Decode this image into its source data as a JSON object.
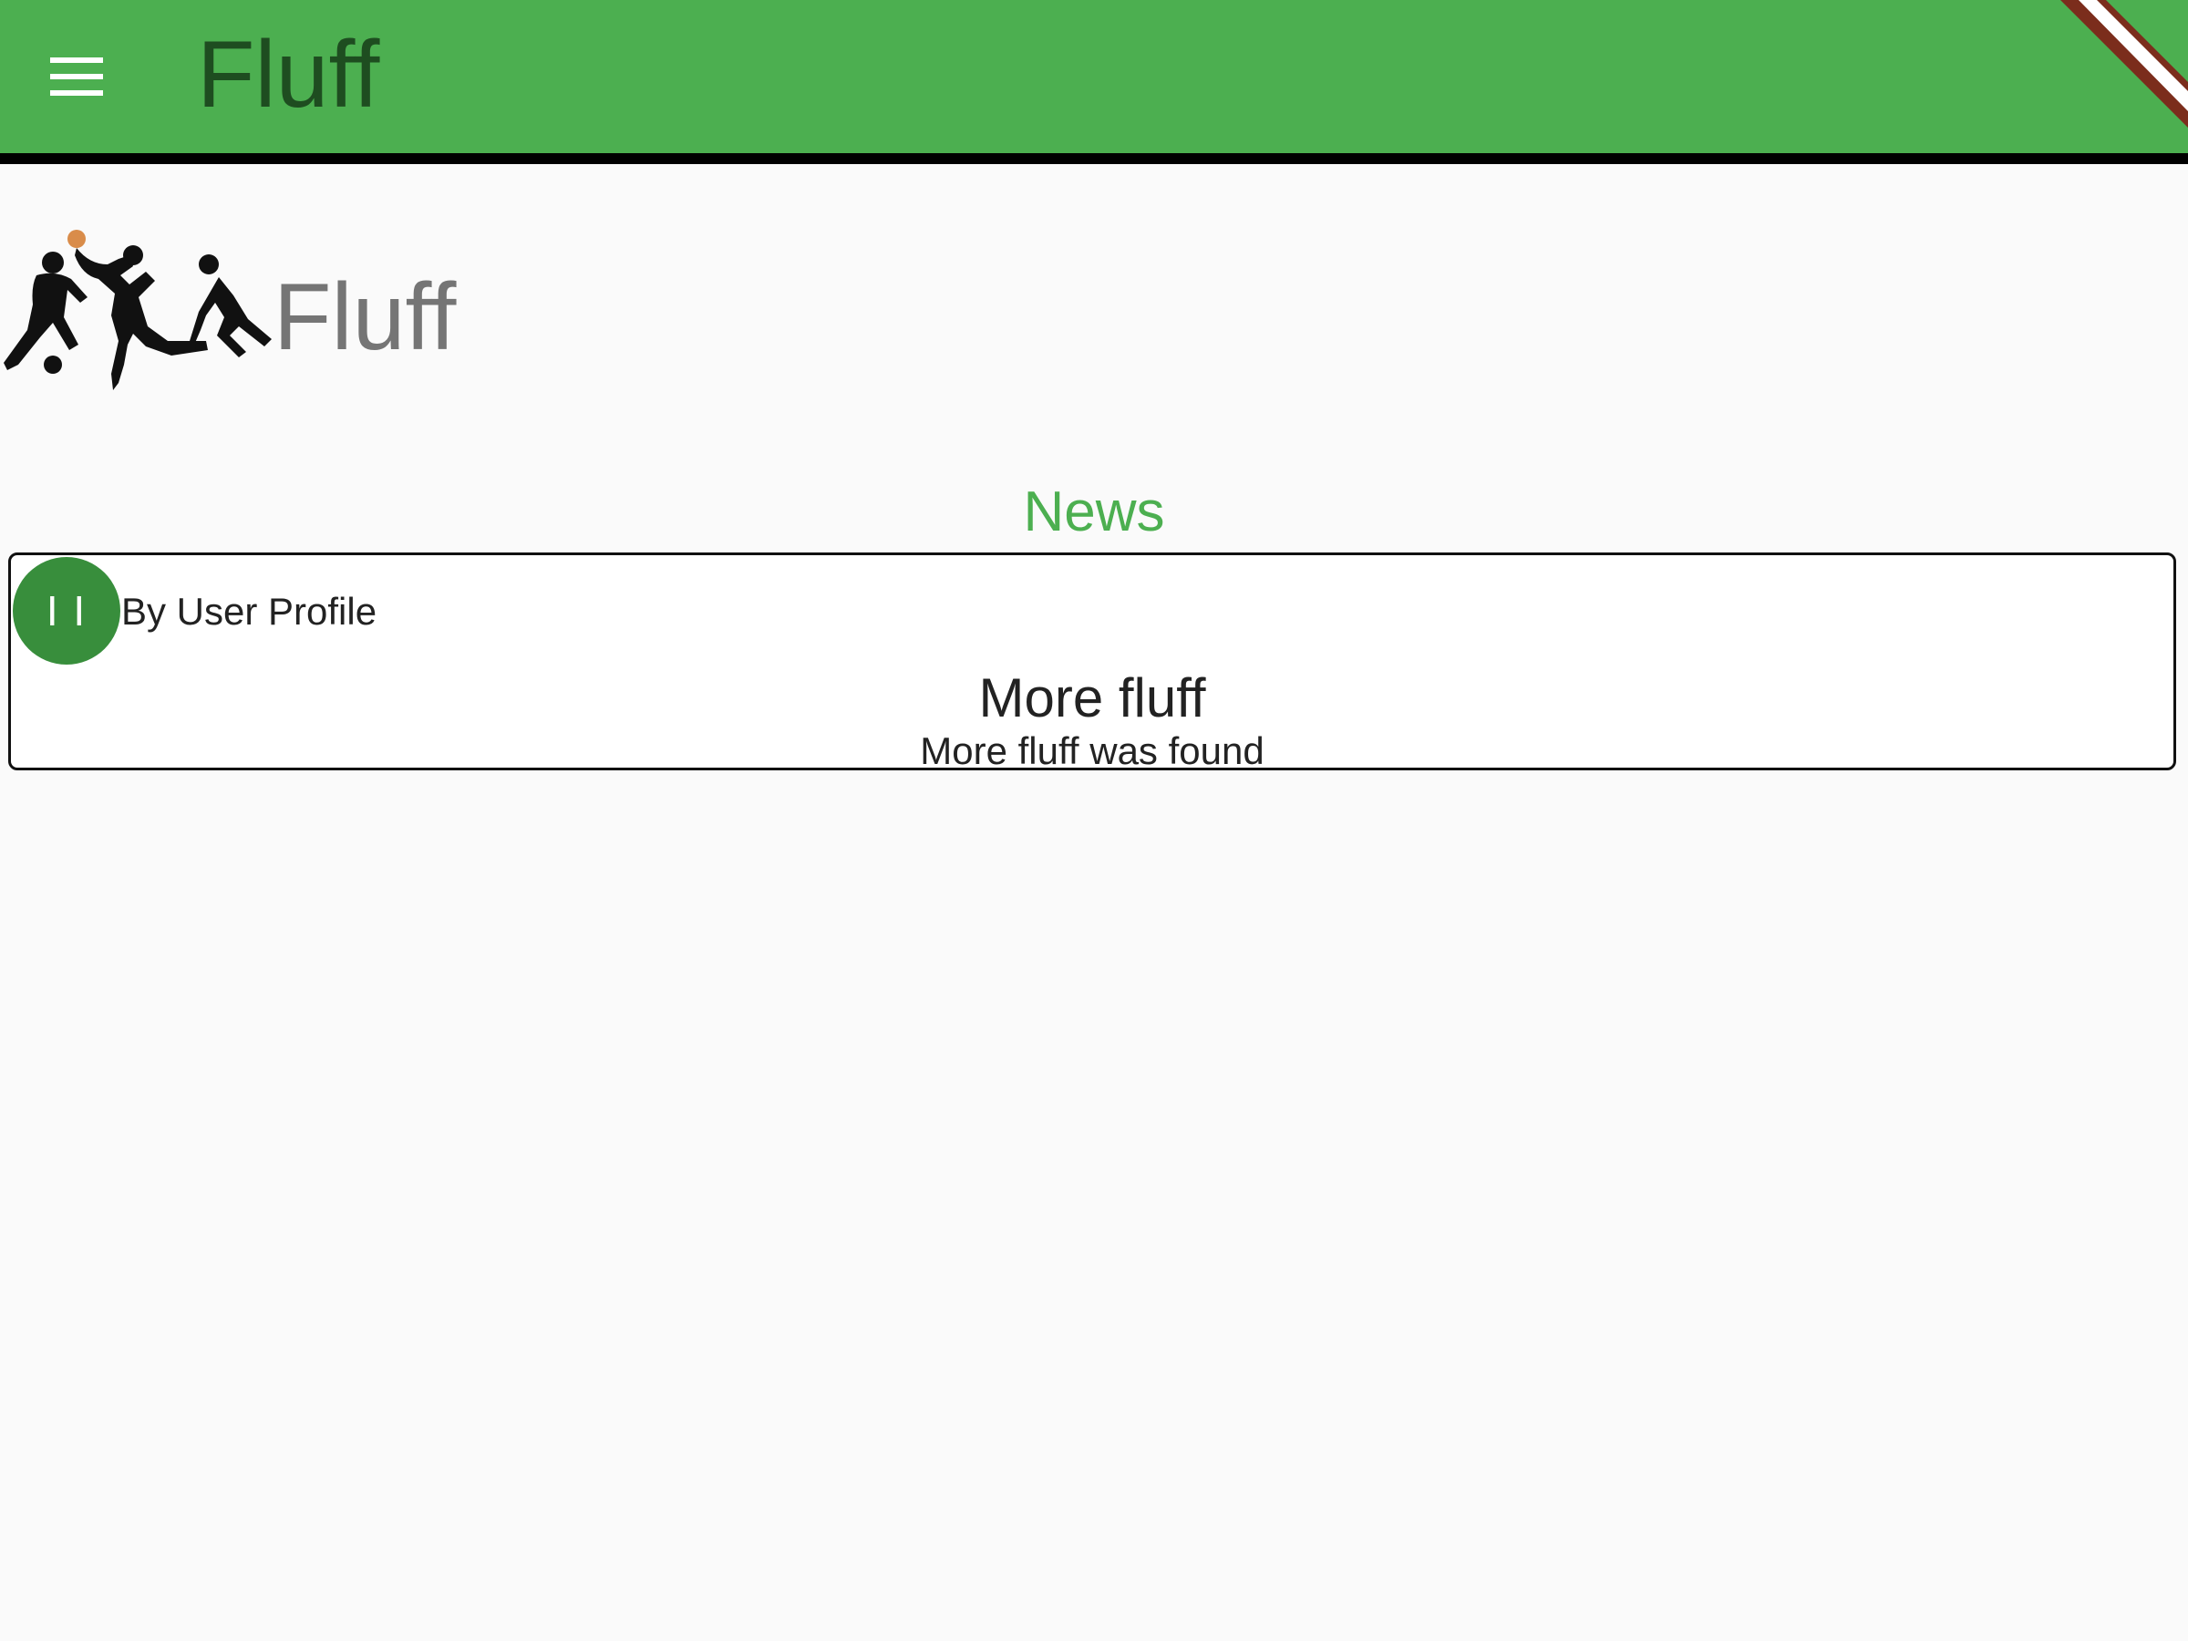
{
  "app_bar": {
    "title": "Fluff",
    "menu_icon": "hamburger-menu-icon",
    "background_color": "#4caf50",
    "title_color": "#1e4d20"
  },
  "hero": {
    "logo_icon": "sports-players-logo",
    "title": "Fluff"
  },
  "news": {
    "section_title": "News",
    "accent_color": "#4caf50",
    "items": [
      {
        "avatar_initials": "I I",
        "avatar_color": "#388e3c",
        "author": "By User Profile",
        "title": "More fluff",
        "subtitle": "More fluff was found"
      }
    ]
  },
  "debug_banner": {
    "icon": "debug-corner-ribbon"
  }
}
